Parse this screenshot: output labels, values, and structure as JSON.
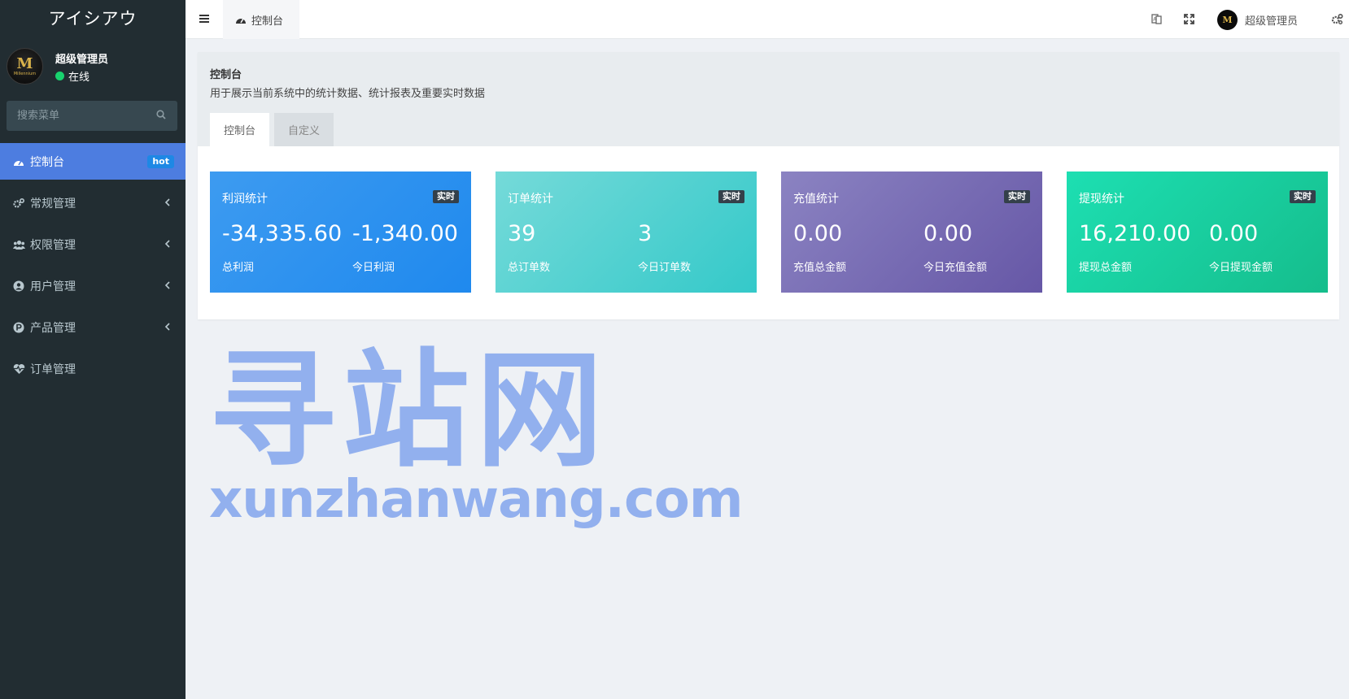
{
  "sidebar": {
    "brand": "アイシアウ",
    "avatar_text": "M",
    "avatar_subtext": "Millennium",
    "user_name": "超级管理员",
    "user_status": "在线",
    "search_placeholder": "搜索菜单",
    "items": [
      {
        "label": "控制台",
        "icon": "dashboard-icon",
        "badge": "hot"
      },
      {
        "label": "常规管理",
        "icon": "gears-icon"
      },
      {
        "label": "权限管理",
        "icon": "users-group-icon"
      },
      {
        "label": "用户管理",
        "icon": "user-circle-icon"
      },
      {
        "label": "产品管理",
        "icon": "product-p-icon"
      },
      {
        "label": "订单管理",
        "icon": "heartbeat-icon"
      }
    ]
  },
  "header": {
    "tab_label": "控制台",
    "user_name": "超级管理员",
    "avatar_text": "M"
  },
  "panel": {
    "title": "控制台",
    "description": "用于展示当前系统中的统计数据、统计报表及重要实时数据",
    "tabs": [
      "控制台",
      "自定义"
    ]
  },
  "cards": [
    {
      "title": "利润统计",
      "tag": "实时",
      "value1": "-34,335.60",
      "label1": "总利润",
      "value2": "-1,340.00",
      "label2": "今日利润"
    },
    {
      "title": "订单统计",
      "tag": "实时",
      "value1": "39",
      "label1": "总订单数",
      "value2": "3",
      "label2": "今日订单数"
    },
    {
      "title": "充值统计",
      "tag": "实时",
      "value1": "0.00",
      "label1": "充值总金额",
      "value2": "0.00",
      "label2": "今日充值金额"
    },
    {
      "title": "提现统计",
      "tag": "实时",
      "value1": "16,210.00",
      "label1": "提现总金额",
      "value2": "0.00",
      "label2": "今日提现金额"
    }
  ],
  "watermark": {
    "cn": "寻站网",
    "en": "xunzhanwang.com"
  },
  "colors": {
    "sidebar_bg": "#222d32",
    "active_menu": "#4d7de0",
    "card_profit": "#2a91ef",
    "card_orders": "#4fd0cf",
    "card_recharge": "#776bb3",
    "card_withdraw": "#19cf9f"
  }
}
